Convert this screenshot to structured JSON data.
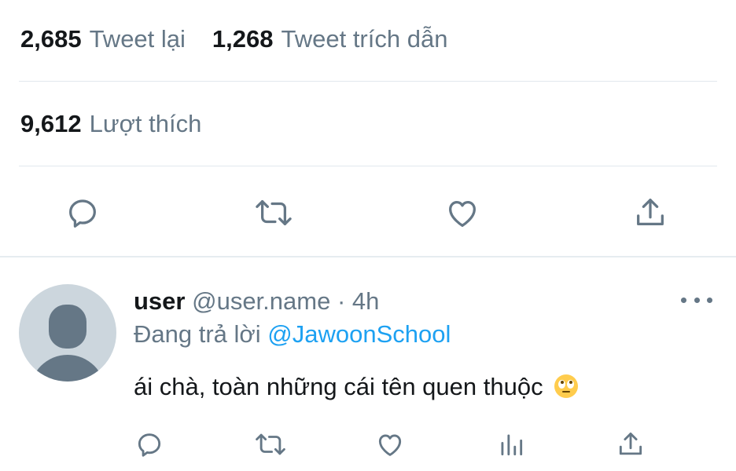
{
  "stats": {
    "retweets_count": "2,685",
    "retweets_label": "Tweet lại",
    "quotes_count": "1,268",
    "quotes_label": "Tweet trích dẫn",
    "likes_count": "9,612",
    "likes_label": "Lượt thích"
  },
  "main_actions": [
    "reply-icon",
    "retweet-icon",
    "like-icon",
    "share-icon"
  ],
  "reply": {
    "name": "user",
    "handle": "@user.name",
    "separator": "·",
    "time": "4h",
    "replying_prefix": "Đang trả lời",
    "replying_to": "@JawoonSchool",
    "text": "ái chà, toàn những cái tên quen thuộc",
    "emoji": "face-with-rolling-eyes",
    "actions": [
      "reply-icon",
      "retweet-icon",
      "like-icon",
      "analytics-icon",
      "share-icon"
    ]
  },
  "colors": {
    "accent": "#1da1f2",
    "secondary_text": "#657786",
    "primary_text": "#14171a",
    "divider": "#e1e8ed"
  }
}
